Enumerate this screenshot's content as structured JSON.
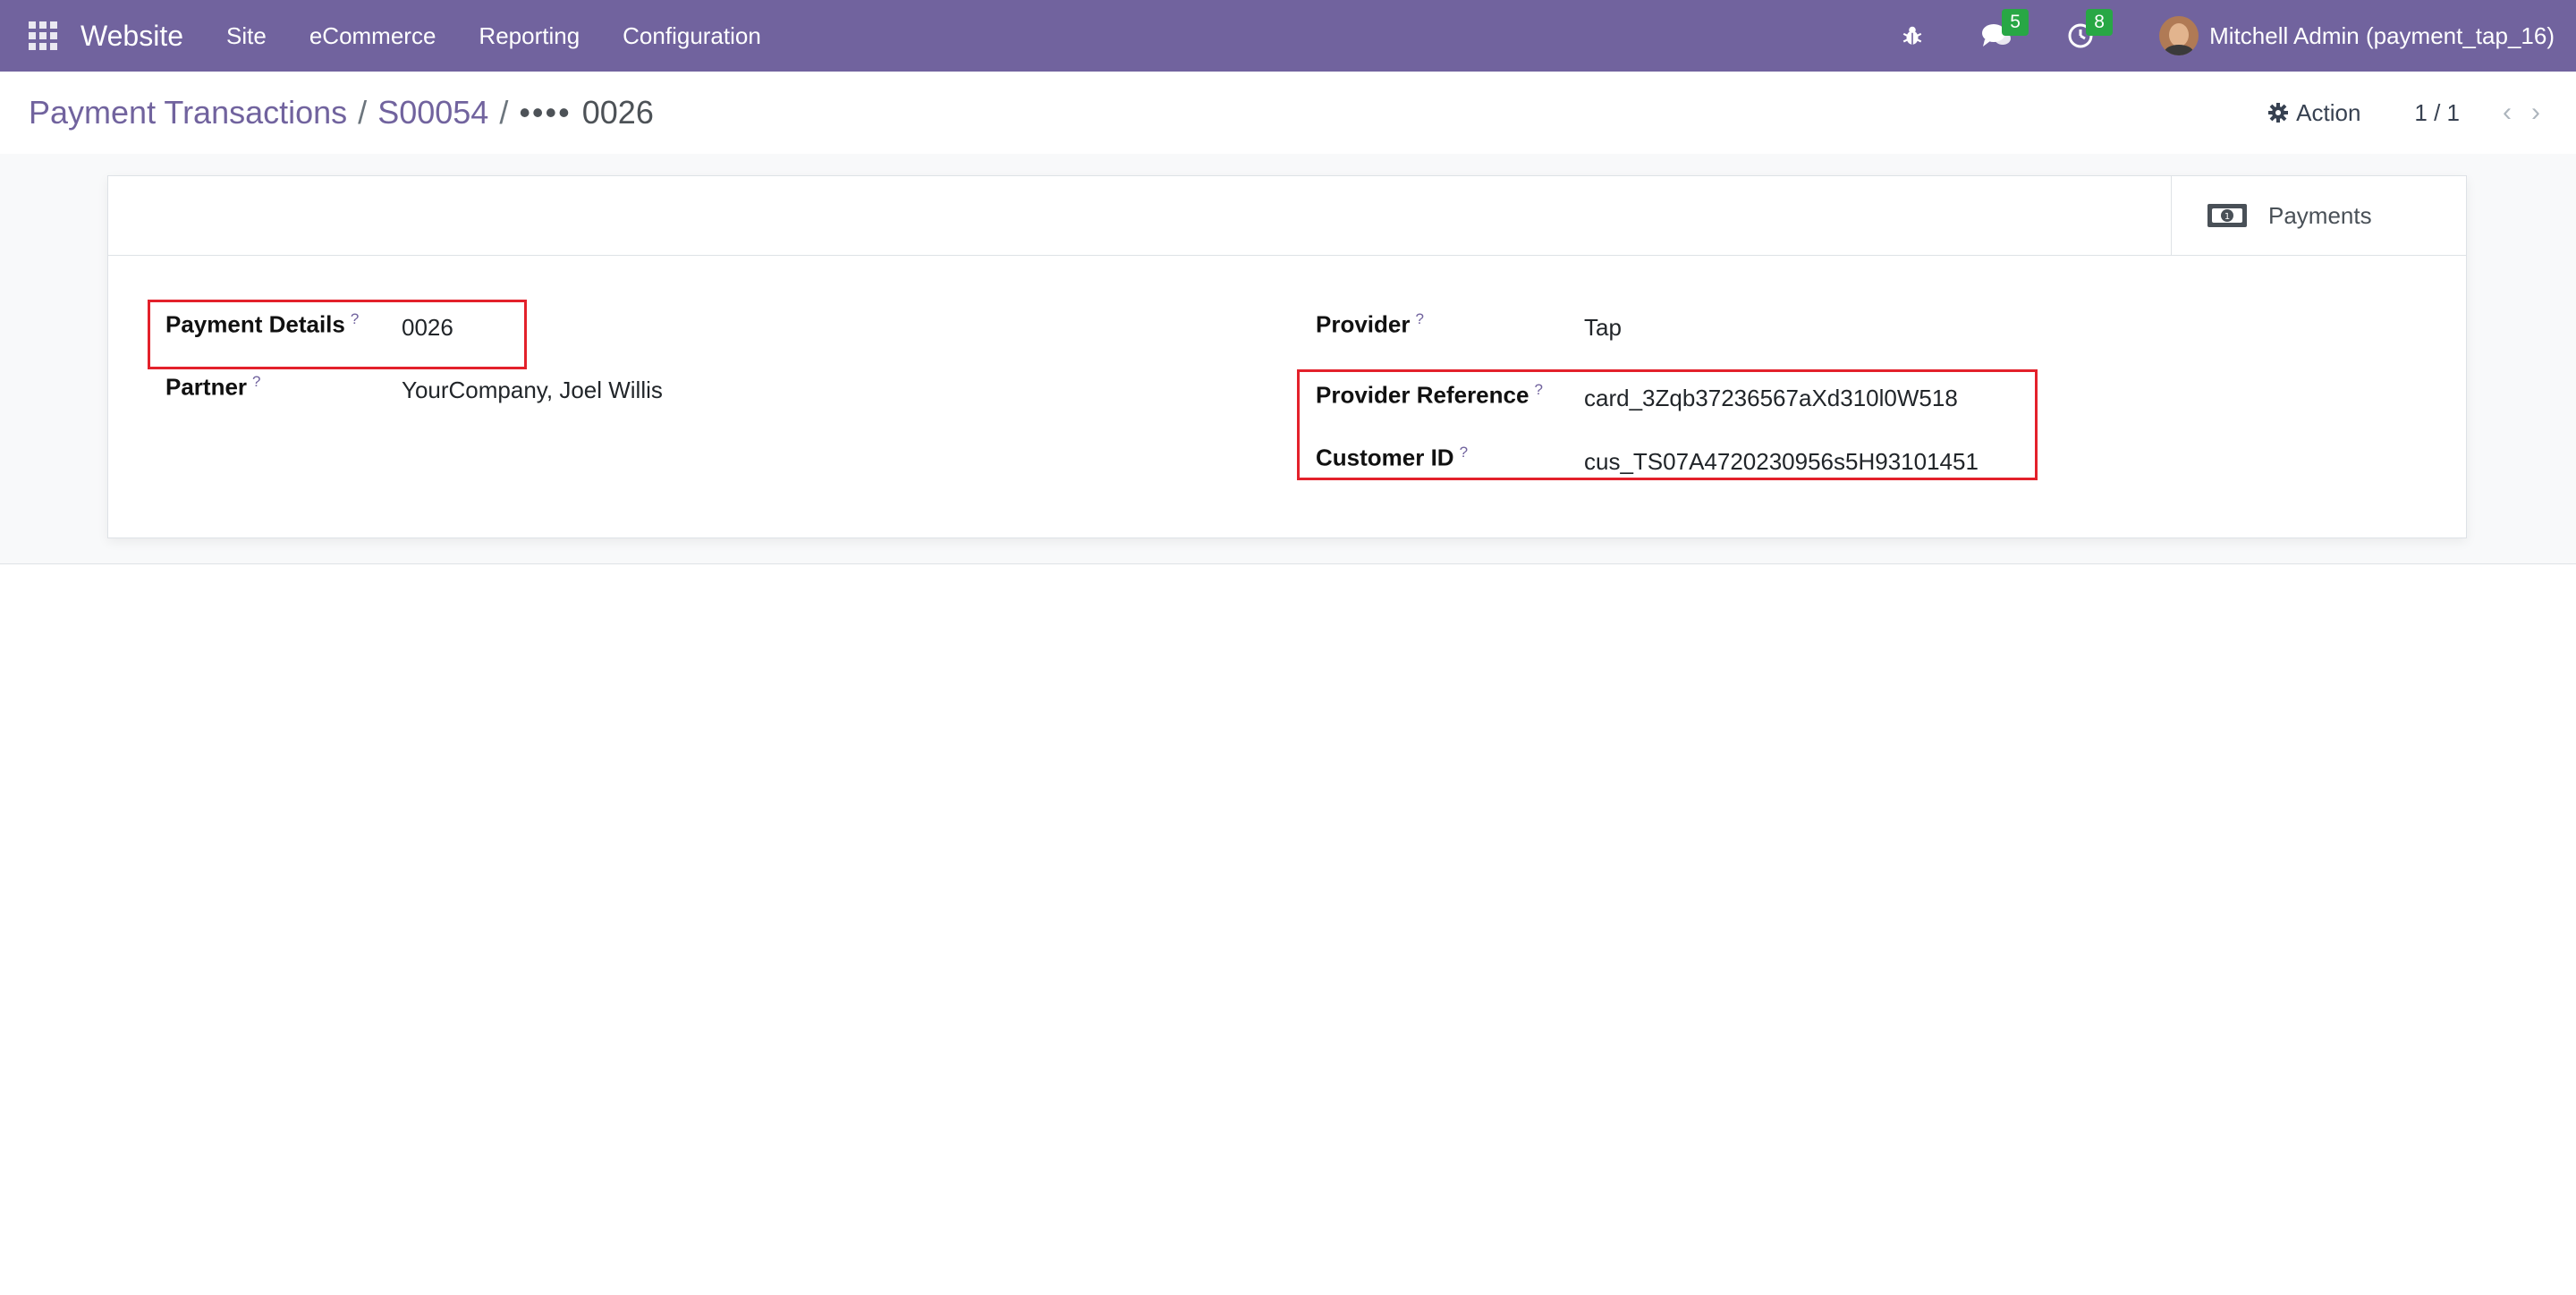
{
  "navbar": {
    "app_name": "Website",
    "menu": [
      "Site",
      "eCommerce",
      "Reporting",
      "Configuration"
    ],
    "messages_count": "5",
    "activities_count": "8",
    "user": "Mitchell Admin (payment_tap_16)",
    "background_color": "#71639e"
  },
  "breadcrumb": {
    "items": [
      "Payment Transactions",
      "S00054"
    ],
    "separator": "/",
    "current_dots": "••••",
    "current_suffix": "0026"
  },
  "control": {
    "action_label": "Action",
    "pager": "1 / 1"
  },
  "smart_buttons": {
    "payments_label": "Payments",
    "payments_icon": "money-bill-icon"
  },
  "form": {
    "payment_details": {
      "label": "Payment Details",
      "help": "?",
      "value": "0026"
    },
    "partner": {
      "label": "Partner",
      "help": "?",
      "value": "YourCompany, Joel Willis"
    },
    "provider": {
      "label": "Provider",
      "help": "?",
      "value": "Tap"
    },
    "provider_reference": {
      "label": "Provider Reference",
      "help": "?",
      "value": "card_3Zqb37236567aXd310l0W518"
    },
    "customer_id": {
      "label": "Customer ID",
      "help": "?",
      "value": "cus_TS07A4720230956s5H93101451"
    }
  },
  "highlight_color": "#e3212b"
}
